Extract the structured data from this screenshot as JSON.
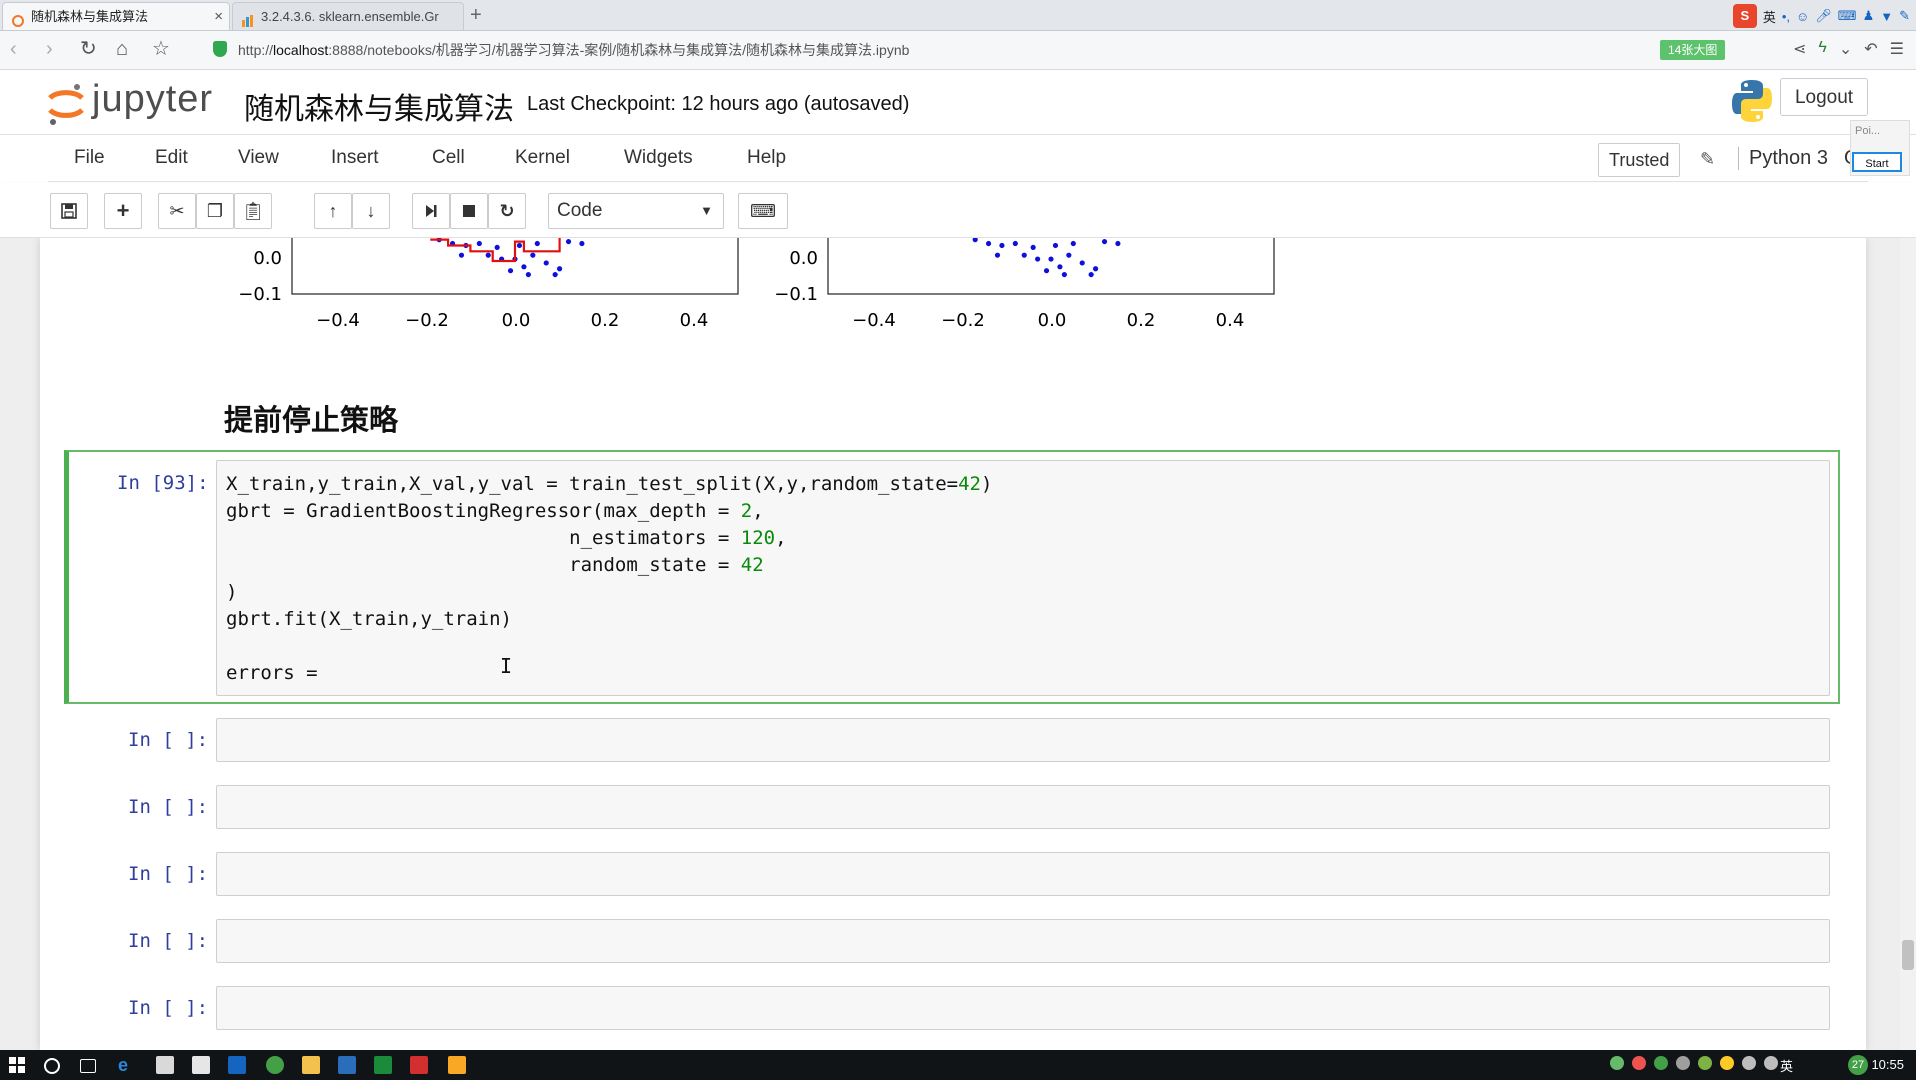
{
  "browser": {
    "tabs": [
      {
        "label": "随机森林与集成算法",
        "active": true
      },
      {
        "label": "3.2.4.3.6. sklearn.ensemble.Gr",
        "active": false
      }
    ],
    "url_prefix": "http://",
    "url_host": "localhost",
    "url_rest": ":8888/notebooks/机器学习/机器学习算法-案例/随机森林与集成算法/随机森林与集成算法.ipynb",
    "badge": "14张大图",
    "tray_ime": "英"
  },
  "jupyter": {
    "logo_text": "jupyter",
    "notebook_title": "随机森林与集成算法",
    "checkpoint": "Last Checkpoint: 12 hours ago (autosaved)",
    "logout_label": "Logout",
    "menu": [
      "File",
      "Edit",
      "View",
      "Insert",
      "Cell",
      "Kernel",
      "Widgets",
      "Help"
    ],
    "trusted_label": "Trusted",
    "kernel_name": "Python 3",
    "kernel_indicator": "O",
    "cell_type": "Code",
    "float_panel": {
      "label": "Poi...",
      "start_label": "Start"
    }
  },
  "plots": {
    "x_ticks": [
      "−0.4",
      "−0.2",
      "0.0",
      "0.2",
      "0.4"
    ],
    "y_ticks": [
      "0.0",
      "−0.1"
    ],
    "series_colors": {
      "line": "#e01010",
      "points": "#1010dd"
    }
  },
  "heading": "提前停止策略",
  "active_cell": {
    "prompt": "In [93]:",
    "lines": [
      "X_train,y_train,X_val,y_val = train_test_split(X,y,random_state=42)",
      "gbrt = GradientBoostingRegressor(max_depth = 2,",
      "                              n_estimators = 120,",
      "                              random_state = 42",
      ")",
      "gbrt.fit(X_train,y_train)",
      "",
      "errors ="
    ]
  },
  "empty_cells": [
    {
      "prompt": "In [ ]:"
    },
    {
      "prompt": "In [ ]:"
    },
    {
      "prompt": "In [ ]:"
    },
    {
      "prompt": "In [ ]:"
    },
    {
      "prompt": "In [ ]:"
    }
  ],
  "taskbar": {
    "clock": "10:55",
    "ime": "英",
    "badge": "27"
  }
}
